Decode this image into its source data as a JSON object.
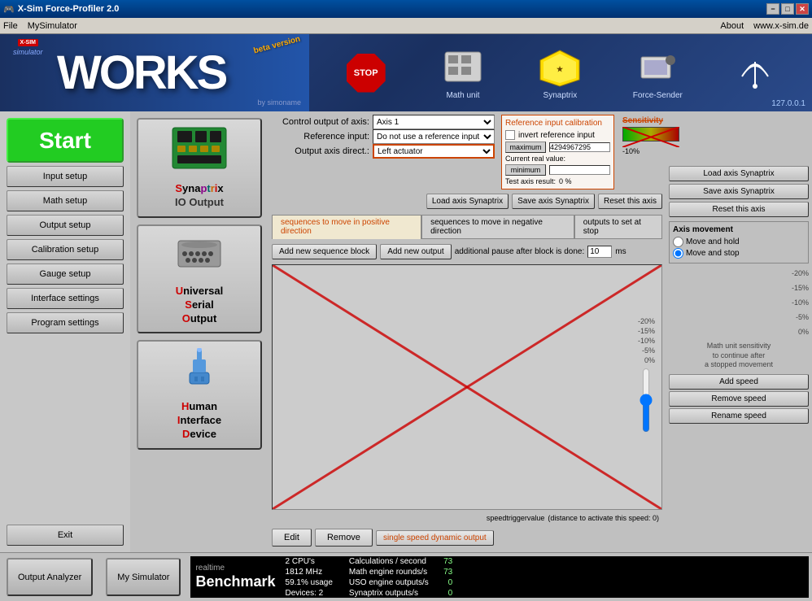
{
  "titlebar": {
    "title": "X-Sim Force-Profiler 2.0",
    "icon": "🎮",
    "btn_min": "−",
    "btn_max": "□",
    "btn_close": "✕"
  },
  "menubar": {
    "file": "File",
    "mysimulator": "MySimulator",
    "about": "About",
    "website": "www.x-sim.de"
  },
  "banner": {
    "logo": "WORKS",
    "subtitle": "simulator",
    "beta": "beta version",
    "bysimoname": "by simoname",
    "ip": "127.0.0.1",
    "nav": [
      {
        "label": "STOP",
        "key": "stop"
      },
      {
        "label": "Math unit",
        "key": "math"
      },
      {
        "label": "Synaptrix",
        "key": "synaptrix"
      },
      {
        "label": "Force-Sender",
        "key": "force"
      },
      {
        "label": "📡",
        "key": "signal"
      }
    ]
  },
  "sidebar": {
    "start": "Start",
    "items": [
      {
        "label": "Input setup",
        "key": "input-setup"
      },
      {
        "label": "Math setup",
        "key": "math-setup"
      },
      {
        "label": "Output setup",
        "key": "output-setup"
      },
      {
        "label": "Calibration setup",
        "key": "calibration-setup"
      },
      {
        "label": "Gauge setup",
        "key": "gauge-setup"
      },
      {
        "label": "Interface settings",
        "key": "interface-settings"
      },
      {
        "label": "Program settings",
        "key": "program-settings"
      }
    ],
    "exit": "Exit"
  },
  "devices": [
    {
      "key": "synaptrix",
      "icon": "🖥",
      "name": "Synaptrix\nIO Output",
      "name_parts": [
        "Synaptrix",
        " IO Output"
      ]
    },
    {
      "key": "uso",
      "icon": "🔌",
      "name": "Universal\nSerial\nOutput",
      "name_parts": [
        "Universal",
        "Serial",
        "Output"
      ]
    },
    {
      "key": "hid",
      "icon": "🔌",
      "name": "Human\nInterface\nDevice",
      "name_parts": [
        "Human",
        "Interface",
        "Device"
      ]
    }
  ],
  "config": {
    "control_output_label": "Control output of axis:",
    "control_output_value": "Axis 1",
    "reference_input_label": "Reference input:",
    "reference_input_value": "Do not use a reference input",
    "output_axis_label": "Output axis direct.:",
    "output_axis_value": "Left actuator",
    "invert_reference": "invert reference input",
    "ref_cal_title": "Reference input calibration",
    "maximum_label": "maximum",
    "maximum_value": "4294967295",
    "minimum_label": "minimum",
    "minimum_value": "",
    "current_val_label": "Current real value:",
    "test_result_label": "Test axis result:",
    "test_val": "0 %",
    "sensitivity_label": "Sensitivity",
    "sens_pct": "-10%"
  },
  "tabs": [
    {
      "label": "sequences to move in positive direction",
      "active": true
    },
    {
      "label": "sequences to move in negative direction",
      "active": false
    },
    {
      "label": "outputs to set at stop",
      "active": false
    }
  ],
  "toolbar": {
    "add_seq_block": "Add new sequence block",
    "add_output": "Add new output",
    "pause_label": "additional pause after block is done:",
    "pause_value": "10",
    "pause_unit": "ms"
  },
  "actions": {
    "edit": "Edit",
    "remove": "Remove",
    "output_type": "single speed dynamic output"
  },
  "axis_controls": {
    "load_synaptrix": "Load axis Synaptrix",
    "save_synaptrix": "Save axis Synaptrix",
    "reset": "Reset this axis",
    "movement_title": "Axis movement",
    "move_hold": "Move and hold",
    "move_stop": "Move and stop",
    "pct_labels": [
      "-20%",
      "-15%",
      "-10%",
      "-5%",
      "0%"
    ],
    "math_sens_text": "Math unit sensitivity\nto continue after\na stopped movement",
    "add_speed": "Add speed",
    "remove_speed": "Remove speed",
    "rename_speed": "Rename speed"
  },
  "speed_trigger": {
    "label": "speedtriggervalue",
    "sublabel": "(distance to activate this speed: 0)"
  },
  "statusbar": {
    "output_analyzer": "Output Analyzer",
    "my_simulator": "My Simulator",
    "benchmark": {
      "realtime": "realtime",
      "bench": "Benchmark",
      "stats": [
        {
          "label": "2 CPU's",
          "sublabel": "1812 MHz",
          "sublabel2": "59.1% usage",
          "sublabel3": "Devices: 2"
        },
        {
          "label": "Calculations / second",
          "val": "73",
          "label2": "Math engine rounds/s",
          "val2": "73",
          "label3": "USO engine outputs/s",
          "val3": "0",
          "label4": "Synaptrix outputs/s",
          "val4": "0"
        }
      ]
    }
  }
}
